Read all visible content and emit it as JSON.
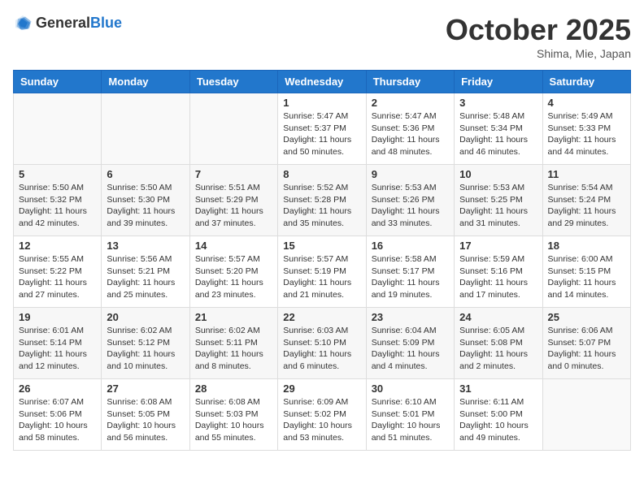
{
  "header": {
    "logo_general": "General",
    "logo_blue": "Blue",
    "month_title": "October 2025",
    "subtitle": "Shima, Mie, Japan"
  },
  "weekdays": [
    "Sunday",
    "Monday",
    "Tuesday",
    "Wednesday",
    "Thursday",
    "Friday",
    "Saturday"
  ],
  "weeks": [
    [
      {
        "day": "",
        "info": ""
      },
      {
        "day": "",
        "info": ""
      },
      {
        "day": "",
        "info": ""
      },
      {
        "day": "1",
        "info": "Sunrise: 5:47 AM\nSunset: 5:37 PM\nDaylight: 11 hours\nand 50 minutes."
      },
      {
        "day": "2",
        "info": "Sunrise: 5:47 AM\nSunset: 5:36 PM\nDaylight: 11 hours\nand 48 minutes."
      },
      {
        "day": "3",
        "info": "Sunrise: 5:48 AM\nSunset: 5:34 PM\nDaylight: 11 hours\nand 46 minutes."
      },
      {
        "day": "4",
        "info": "Sunrise: 5:49 AM\nSunset: 5:33 PM\nDaylight: 11 hours\nand 44 minutes."
      }
    ],
    [
      {
        "day": "5",
        "info": "Sunrise: 5:50 AM\nSunset: 5:32 PM\nDaylight: 11 hours\nand 42 minutes."
      },
      {
        "day": "6",
        "info": "Sunrise: 5:50 AM\nSunset: 5:30 PM\nDaylight: 11 hours\nand 39 minutes."
      },
      {
        "day": "7",
        "info": "Sunrise: 5:51 AM\nSunset: 5:29 PM\nDaylight: 11 hours\nand 37 minutes."
      },
      {
        "day": "8",
        "info": "Sunrise: 5:52 AM\nSunset: 5:28 PM\nDaylight: 11 hours\nand 35 minutes."
      },
      {
        "day": "9",
        "info": "Sunrise: 5:53 AM\nSunset: 5:26 PM\nDaylight: 11 hours\nand 33 minutes."
      },
      {
        "day": "10",
        "info": "Sunrise: 5:53 AM\nSunset: 5:25 PM\nDaylight: 11 hours\nand 31 minutes."
      },
      {
        "day": "11",
        "info": "Sunrise: 5:54 AM\nSunset: 5:24 PM\nDaylight: 11 hours\nand 29 minutes."
      }
    ],
    [
      {
        "day": "12",
        "info": "Sunrise: 5:55 AM\nSunset: 5:22 PM\nDaylight: 11 hours\nand 27 minutes."
      },
      {
        "day": "13",
        "info": "Sunrise: 5:56 AM\nSunset: 5:21 PM\nDaylight: 11 hours\nand 25 minutes."
      },
      {
        "day": "14",
        "info": "Sunrise: 5:57 AM\nSunset: 5:20 PM\nDaylight: 11 hours\nand 23 minutes."
      },
      {
        "day": "15",
        "info": "Sunrise: 5:57 AM\nSunset: 5:19 PM\nDaylight: 11 hours\nand 21 minutes."
      },
      {
        "day": "16",
        "info": "Sunrise: 5:58 AM\nSunset: 5:17 PM\nDaylight: 11 hours\nand 19 minutes."
      },
      {
        "day": "17",
        "info": "Sunrise: 5:59 AM\nSunset: 5:16 PM\nDaylight: 11 hours\nand 17 minutes."
      },
      {
        "day": "18",
        "info": "Sunrise: 6:00 AM\nSunset: 5:15 PM\nDaylight: 11 hours\nand 14 minutes."
      }
    ],
    [
      {
        "day": "19",
        "info": "Sunrise: 6:01 AM\nSunset: 5:14 PM\nDaylight: 11 hours\nand 12 minutes."
      },
      {
        "day": "20",
        "info": "Sunrise: 6:02 AM\nSunset: 5:12 PM\nDaylight: 11 hours\nand 10 minutes."
      },
      {
        "day": "21",
        "info": "Sunrise: 6:02 AM\nSunset: 5:11 PM\nDaylight: 11 hours\nand 8 minutes."
      },
      {
        "day": "22",
        "info": "Sunrise: 6:03 AM\nSunset: 5:10 PM\nDaylight: 11 hours\nand 6 minutes."
      },
      {
        "day": "23",
        "info": "Sunrise: 6:04 AM\nSunset: 5:09 PM\nDaylight: 11 hours\nand 4 minutes."
      },
      {
        "day": "24",
        "info": "Sunrise: 6:05 AM\nSunset: 5:08 PM\nDaylight: 11 hours\nand 2 minutes."
      },
      {
        "day": "25",
        "info": "Sunrise: 6:06 AM\nSunset: 5:07 PM\nDaylight: 11 hours\nand 0 minutes."
      }
    ],
    [
      {
        "day": "26",
        "info": "Sunrise: 6:07 AM\nSunset: 5:06 PM\nDaylight: 10 hours\nand 58 minutes."
      },
      {
        "day": "27",
        "info": "Sunrise: 6:08 AM\nSunset: 5:05 PM\nDaylight: 10 hours\nand 56 minutes."
      },
      {
        "day": "28",
        "info": "Sunrise: 6:08 AM\nSunset: 5:03 PM\nDaylight: 10 hours\nand 55 minutes."
      },
      {
        "day": "29",
        "info": "Sunrise: 6:09 AM\nSunset: 5:02 PM\nDaylight: 10 hours\nand 53 minutes."
      },
      {
        "day": "30",
        "info": "Sunrise: 6:10 AM\nSunset: 5:01 PM\nDaylight: 10 hours\nand 51 minutes."
      },
      {
        "day": "31",
        "info": "Sunrise: 6:11 AM\nSunset: 5:00 PM\nDaylight: 10 hours\nand 49 minutes."
      },
      {
        "day": "",
        "info": ""
      }
    ]
  ]
}
